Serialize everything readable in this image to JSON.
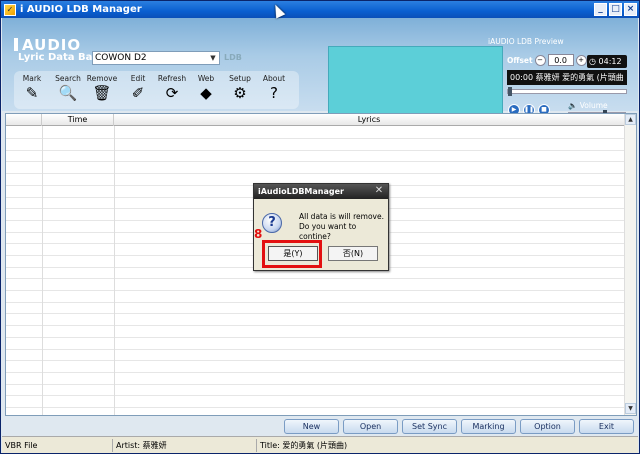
{
  "window": {
    "title": "i AUDIO LDB Manager",
    "app_icon": "check-icon"
  },
  "header": {
    "logo": "AUDIO",
    "lyric_label": "Lyric Data Base",
    "device": "COWON D2",
    "ldb_tag": "LDB",
    "toolbar": [
      {
        "label": "Mark",
        "icon": "pencil-icon",
        "glyph": "✎"
      },
      {
        "label": "Search",
        "icon": "magnifier-icon",
        "glyph": "🔍"
      },
      {
        "label": "Remove",
        "icon": "trash-icon",
        "glyph": "🗑"
      },
      {
        "label": "Edit",
        "icon": "edit-icon",
        "glyph": "✐"
      },
      {
        "label": "Refresh",
        "icon": "refresh-icon",
        "glyph": "⟳"
      },
      {
        "label": "Web",
        "icon": "web-icon",
        "glyph": "◆"
      },
      {
        "label": "Setup",
        "icon": "setup-icon",
        "glyph": "⚙"
      },
      {
        "label": "About",
        "icon": "help-icon",
        "glyph": "?"
      }
    ]
  },
  "preview": {
    "title": "iAUDIO LDB Preview",
    "offset_label": "Offset",
    "offset_value": "0.0",
    "time_total": "04:12",
    "lcd_text": "00:00 蔡雅妍 爱的勇氣 (片頭曲",
    "volume_label": "Volume"
  },
  "table": {
    "columns": [
      "Time",
      "Lyrics"
    ]
  },
  "bottom_buttons": [
    "New",
    "Open",
    "Set Sync",
    "Marking",
    "Option",
    "Exit"
  ],
  "status": {
    "file": "VBR File",
    "artist": "Artist: 蔡雅妍",
    "title": "Title: 爱的勇氣 (片頭曲)"
  },
  "dialog": {
    "title": "iAudioLDBManager",
    "message_line1": "All data is will remove.",
    "message_line2": "Do you want to contine?",
    "yes_label": "是(Y)",
    "no_label": "否(N)"
  },
  "annotation": {
    "step": "8",
    "color": "#e31010"
  }
}
